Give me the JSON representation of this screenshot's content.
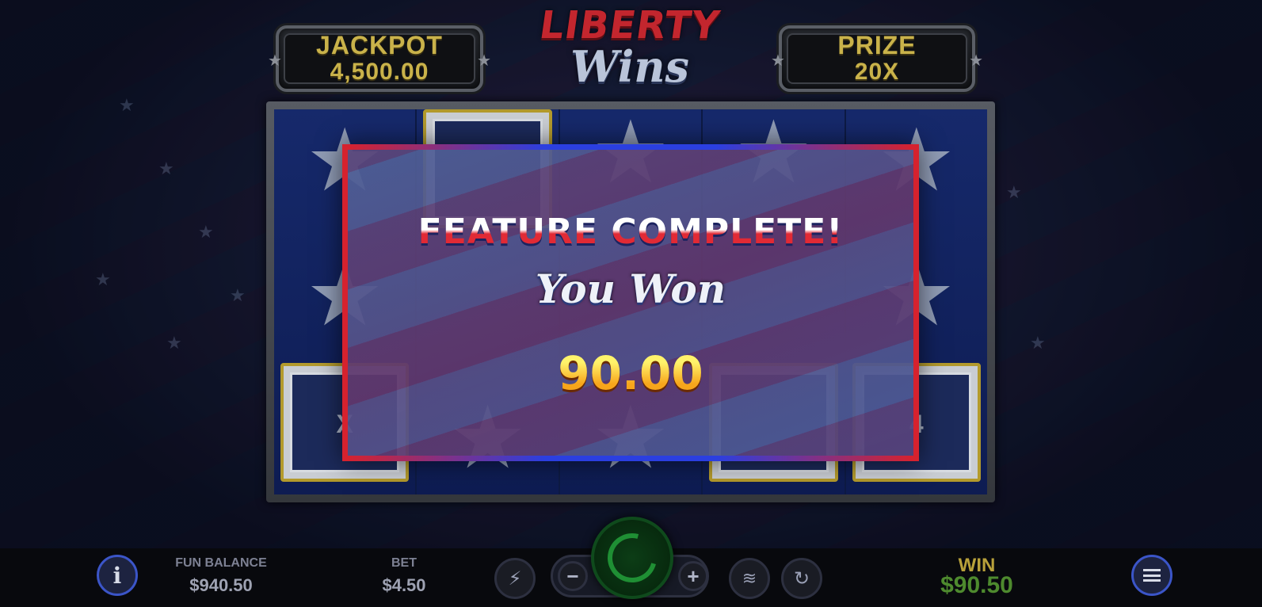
{
  "logo": {
    "line1": "LIBERTY",
    "line2": "Wins"
  },
  "jackpot": {
    "title": "JACKPOT",
    "value": "4,500.00"
  },
  "prize": {
    "title": "PRIZE",
    "value": "20X"
  },
  "reels": {
    "tile_left_text": "X",
    "tile_right_text": "4"
  },
  "dialog": {
    "title": "FEATURE COMPLETE!",
    "subtitle": "You Won",
    "amount": "90.00"
  },
  "bottom_bar": {
    "fun_balance_label": "FUN BALANCE",
    "fun_balance_value": "$940.50",
    "bet_label": "BET",
    "bet_value": "$4.50",
    "win_label": "WIN",
    "win_value": "$90.50",
    "icons": {
      "info": "info-icon",
      "turbo": "lightning-icon",
      "minus": "minus-icon",
      "plus": "plus-icon",
      "spin": "spin-icon",
      "coins": "coins-icon",
      "autoplay": "autoplay-icon",
      "menu": "menu-icon"
    }
  },
  "colors": {
    "gold": "#c9b24a",
    "red": "#d6222e",
    "blue": "#2b3fe0",
    "win_green": "#4e8a2e"
  }
}
